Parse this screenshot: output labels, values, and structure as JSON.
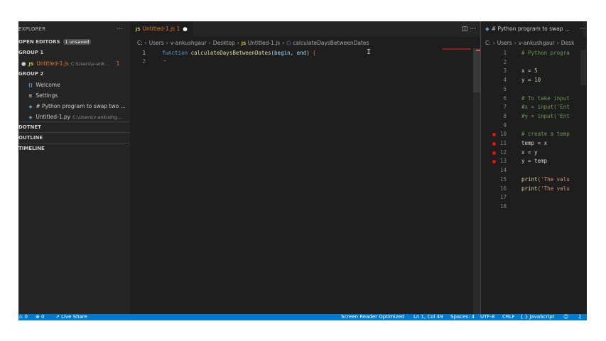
{
  "sidebar": {
    "title": "EXPLORER",
    "more": "···",
    "open_editors": {
      "label": "OPEN EDITORS",
      "badge": "1 unsaved"
    },
    "group1": {
      "label": "GROUP 1",
      "items": [
        {
          "icon": "JS",
          "name": "Untitled-1.js",
          "path": "C:\\Users\\v-ank...",
          "count": "1"
        }
      ]
    },
    "group2": {
      "label": "GROUP 2",
      "items": [
        {
          "icon": "⟨⟩",
          "name": "Welcome"
        },
        {
          "icon": "≡",
          "name": "Settings"
        },
        {
          "icon": "◆",
          "name": "# Python program to swap two ..."
        },
        {
          "icon": "◆",
          "name": "Untitled-1.py",
          "path": "C:\\Users\\v-ankushg..."
        }
      ]
    },
    "sections": [
      "DOTNET",
      "OUTLINE",
      "TIMELINE"
    ]
  },
  "editor1": {
    "tab": {
      "icon": "JS",
      "name": "Untitled-1.js 1",
      "dot": "●"
    },
    "actions": "◫ ···",
    "breadcrumbs": [
      "C:",
      "Users",
      "v-ankushgaur",
      "Desktop",
      "Untitled-1.js",
      "calculateDaysBetweenDates"
    ],
    "lines": [
      {
        "n": "1",
        "kw": "function",
        "fn": "calculateDaysBetweenDates",
        "p1": "(",
        "a": "begin",
        "c": ", ",
        "b": "end",
        "p2": ")",
        "brace": "{"
      },
      {
        "n": "2"
      }
    ],
    "squiggle": "~",
    "cursor": "I"
  },
  "editor2": {
    "tab": {
      "icon": "◆",
      "name": "# Python program to swap ...",
      "more": "···"
    },
    "breadcrumbs": [
      "C:",
      "Users",
      "v-ankushgaur",
      "Desk"
    ],
    "lines": [
      {
        "n": "1",
        "t": "# Python progra",
        "cls": "cm"
      },
      {
        "n": "2",
        "t": ""
      },
      {
        "n": "3",
        "t": "x = ",
        "v": "5"
      },
      {
        "n": "4",
        "t": "y = ",
        "v": "10"
      },
      {
        "n": "5",
        "t": ""
      },
      {
        "n": "6",
        "t": "# To take input",
        "cls": "cm"
      },
      {
        "n": "7",
        "t": "#x = input('Ent",
        "cls": "cm"
      },
      {
        "n": "8",
        "t": "#y = input('Ent",
        "cls": "cm"
      },
      {
        "n": "9",
        "t": ""
      },
      {
        "n": "10",
        "t": "# create a temp",
        "cls": "cm",
        "bp": true
      },
      {
        "n": "11",
        "t": "temp = x",
        "bp": true
      },
      {
        "n": "12",
        "t": "x = y",
        "bp": true
      },
      {
        "n": "13",
        "t": "y = temp",
        "bp": true
      },
      {
        "n": "14",
        "t": ""
      },
      {
        "n": "15",
        "t": "print",
        "s": "('The valu"
      },
      {
        "n": "16",
        "t": "print",
        "s": "('The valu"
      },
      {
        "n": "17",
        "t": ""
      },
      {
        "n": "18",
        "t": ""
      }
    ]
  },
  "status": {
    "errors": "⚠ 0",
    "warnings": "⊗ 0",
    "liveshare": "Live Share",
    "reader": "Screen Reader Optimized",
    "position": "Ln 1, Col 49",
    "spaces": "Spaces: 4",
    "encoding": "UTF-8",
    "eol": "CRLF",
    "language": "{ } JavaScript",
    "feedback": "☺",
    "bell": "♫"
  },
  "colors": {
    "accent": "#007acc",
    "editor_bg": "#1e1e1e",
    "sidebar_bg": "#252526",
    "error": "#f14c4c"
  }
}
